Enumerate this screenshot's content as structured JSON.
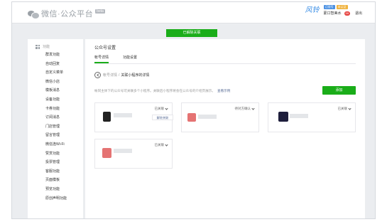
{
  "brand": {
    "title": "微信·公众平台",
    "beta": "beta"
  },
  "user": {
    "logo_text": "风铃",
    "tag_blue": "订阅号",
    "tag_orange": "未认证",
    "name": "蒙口智美水",
    "messages": "99",
    "logout": "退出"
  },
  "notice": "已解除关联",
  "sidebar": {
    "head": "功能",
    "items": [
      "群发功能",
      "自动回复",
      "自定义菜单",
      "微信小店",
      "模板消息",
      "设备功能",
      "卡券功能",
      "订阅消息",
      "门店管理",
      "留言管理",
      "微信连Wi-Fi",
      "赞赏功能",
      "投票管理",
      "客服功能",
      "页面模板",
      "预览功能",
      "原创声明功能"
    ]
  },
  "main": {
    "title": "公众号设置",
    "tabs": [
      "帐号详情",
      "功能设置"
    ],
    "crumb_parent": "帐号详情",
    "crumb_sep": "/",
    "crumb_current": "关联小程序的详情",
    "desc": "帐同主体下的公众号可关联多个小程序。关联后小程序将会在公众号的介绍页展示。",
    "desc_link": "查看示例",
    "add_label": "添加"
  },
  "cards": [
    {
      "status": "已关联",
      "popup": "解除关联",
      "accent": "#222222"
    },
    {
      "status": "待对方确认",
      "accent": "#e57373"
    },
    {
      "status": "已关联",
      "accent": "#1e1e3c"
    },
    {
      "status": "已关联",
      "accent": "#e57373"
    }
  ],
  "colors": {
    "accent_green": "#1aad19",
    "link_blue": "#576b95"
  }
}
